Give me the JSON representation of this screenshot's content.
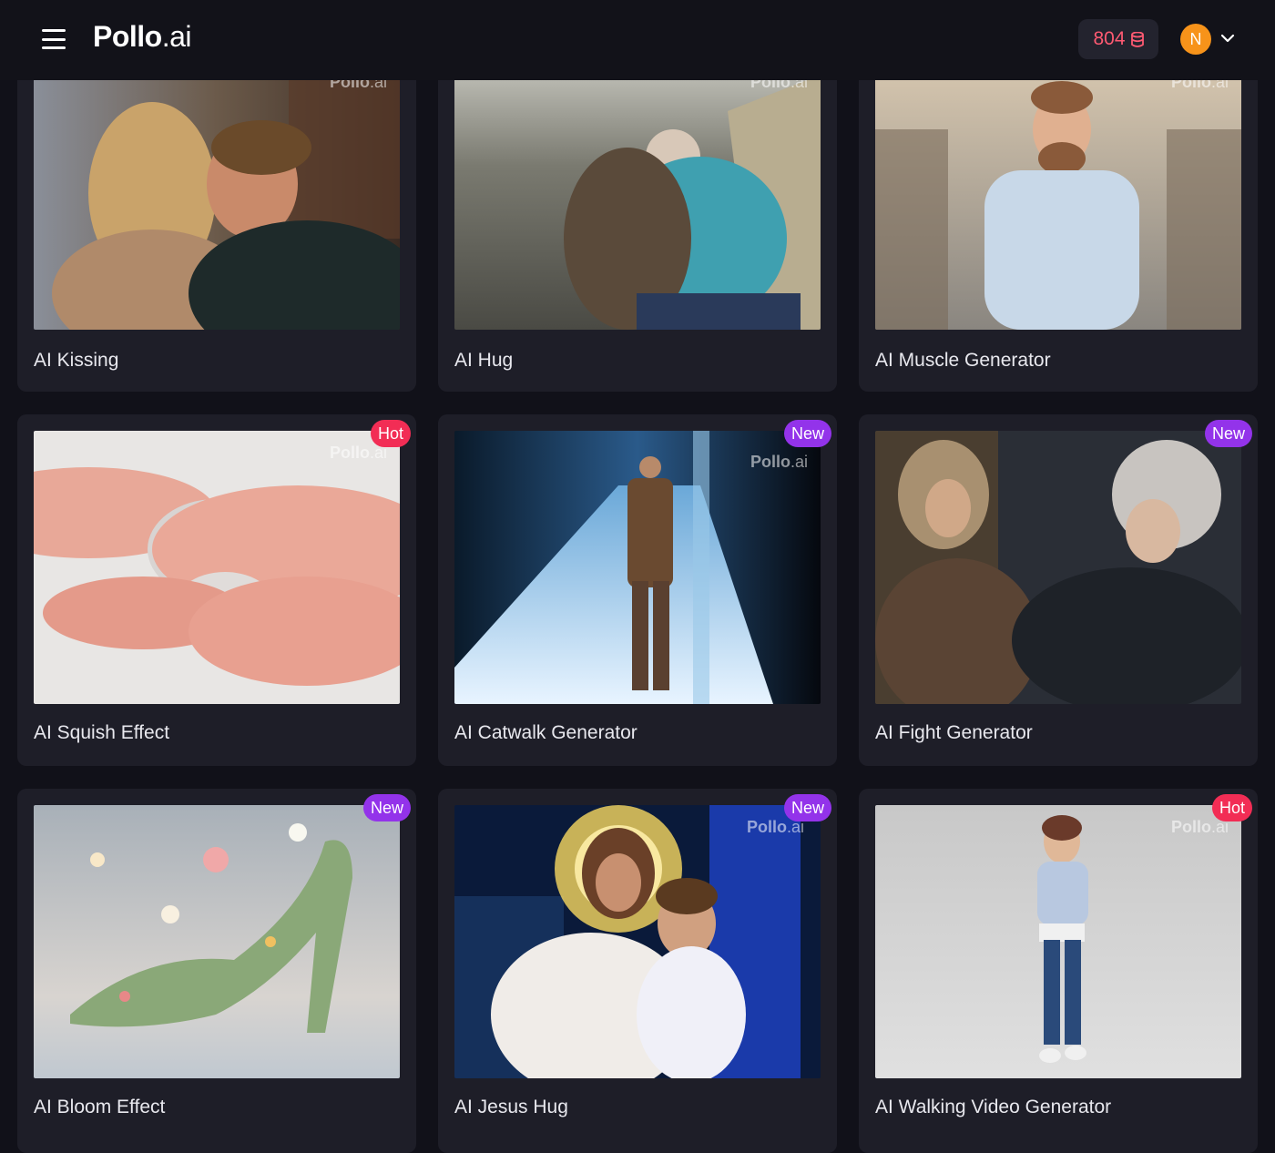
{
  "header": {
    "logo_main": "Pollo",
    "logo_suffix": ".ai",
    "credits": "804",
    "avatar_initial": "N"
  },
  "cards": [
    {
      "title": "AI Kissing",
      "badge": "",
      "watermark": "Pollo",
      "watermark_suffix": ".ai"
    },
    {
      "title": "AI Hug",
      "badge": "",
      "watermark": "Pollo",
      "watermark_suffix": ".ai"
    },
    {
      "title": "AI Muscle Generator",
      "badge": "",
      "watermark": "Pollo",
      "watermark_suffix": ".ai"
    },
    {
      "title": "AI Squish Effect",
      "badge": "Hot",
      "watermark": "Pollo",
      "watermark_suffix": ".ai"
    },
    {
      "title": "AI Catwalk Generator",
      "badge": "New",
      "watermark": "Pollo",
      "watermark_suffix": ".ai"
    },
    {
      "title": "AI Fight Generator",
      "badge": "New",
      "watermark": "",
      "watermark_suffix": ""
    },
    {
      "title": "AI Bloom Effect",
      "badge": "New",
      "watermark": "",
      "watermark_suffix": ""
    },
    {
      "title": "AI Jesus Hug",
      "badge": "New",
      "watermark": "Pollo",
      "watermark_suffix": ".ai"
    },
    {
      "title": "AI Walking Video Generator",
      "badge": "Hot",
      "watermark": "Pollo",
      "watermark_suffix": ".ai"
    }
  ],
  "colors": {
    "background": "#111119",
    "card": "#1e1e28",
    "hot_badge": "#f22d55",
    "new_badge": "#9333ea",
    "credits_text": "#ff5a72",
    "avatar": "#f7931a"
  },
  "icons": {
    "menu": "hamburger-menu-icon",
    "credits": "coin-stack-icon",
    "dropdown": "chevron-down-icon"
  }
}
